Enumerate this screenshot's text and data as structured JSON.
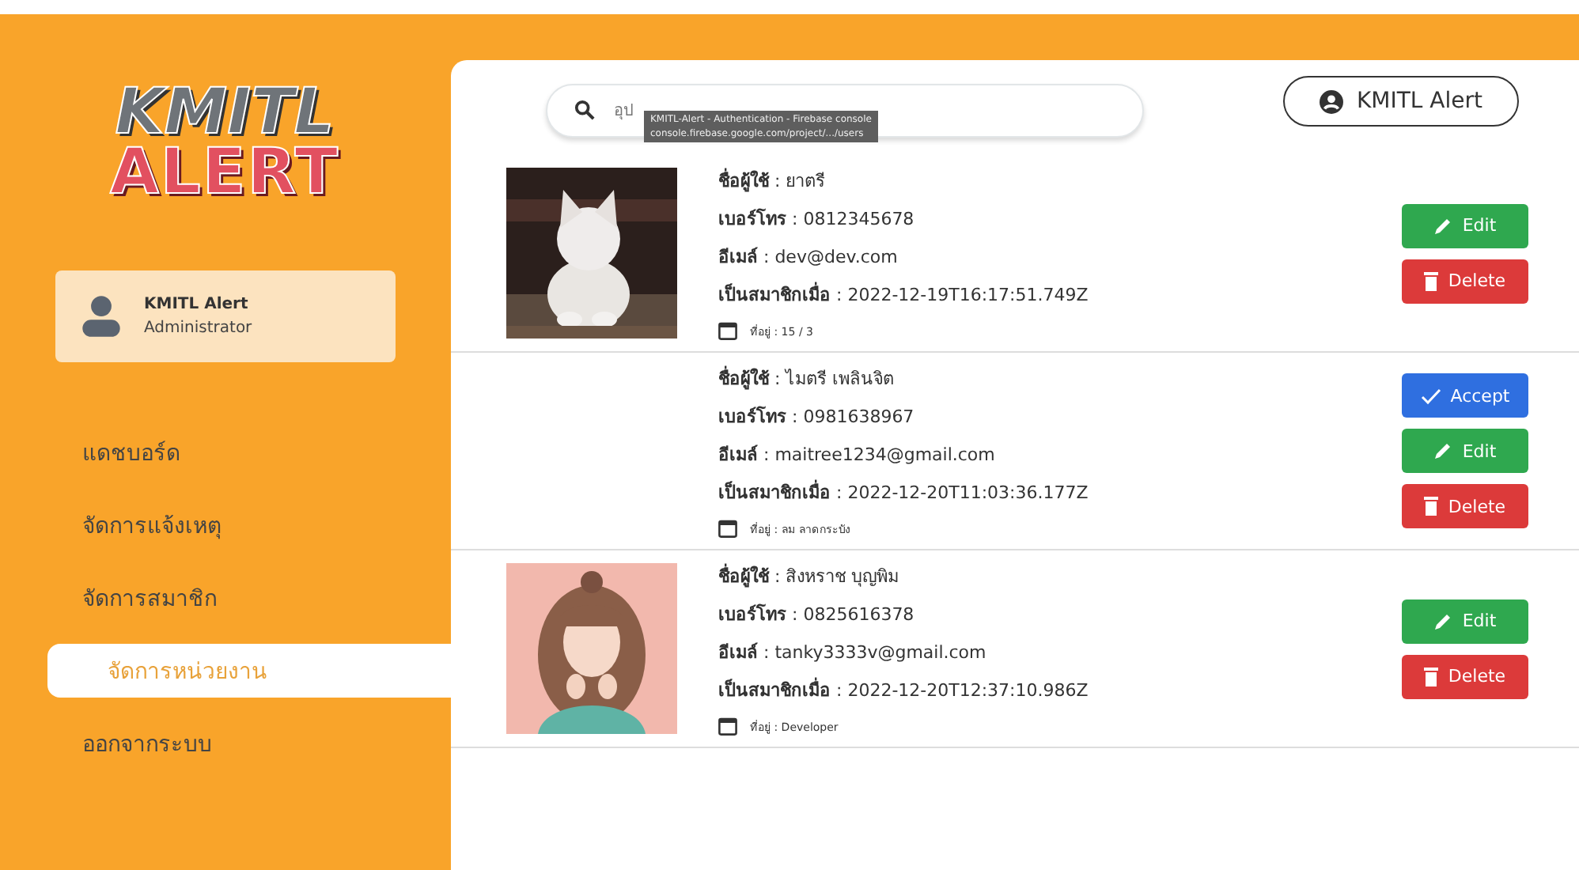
{
  "logo": {
    "line_1": "KMITL",
    "line_2": "ALERT"
  },
  "user_card": {
    "name": "KMITL Alert",
    "role": "Administrator"
  },
  "sidebar": {
    "items": [
      {
        "label": "แดชบอร์ด",
        "selected": false
      },
      {
        "label": "จัดการแจ้งเหตุ",
        "selected": false
      },
      {
        "label": "จัดการสมาชิก",
        "selected": false
      },
      {
        "label": "จัดการหน่วยงาน",
        "selected": true
      },
      {
        "label": "ออกจากระบบ",
        "selected": false
      }
    ]
  },
  "search": {
    "placeholder": "อุป"
  },
  "tooltip": {
    "title": "KMITL-Alert - Authentication - Firebase console",
    "url": "console.firebase.google.com/project/.../users"
  },
  "account_button": {
    "label": "KMITL Alert"
  },
  "members": [
    {
      "photo": {
        "kind": "picture"
      },
      "fields": [
        "**ชื่อผู้ใช้** : ยาตรี",
        "**เบอร์โทร** : 0812345678",
        "**อีเมล์** : dev@dev.com",
        "**เป็นสมาชิกเมื่อ** : 2022-12-19T16:17:51.749Z"
      ],
      "address": "ที่อยู่ : 15 / 3",
      "buttons": [
        {
          "kind": "edit",
          "label": "Edit"
        },
        {
          "kind": "delete",
          "label": "Delete"
        }
      ]
    },
    {
      "fields": [
        "**ชื่อผู้ใช้** : ไมตรี เพลินจิต",
        "**เบอร์โทร** : 0981638967",
        "**อีเมล์** : maitree1234@gmail.com",
        "**เป็นสมาชิกเมื่อ** : 2022-12-20T11:03:36.177Z"
      ],
      "address": "ที่อยู่ : ลม ลาดกระบัง",
      "buttons": [
        {
          "kind": "accept",
          "label": "Accept"
        },
        {
          "kind": "edit",
          "label": "Edit"
        },
        {
          "kind": "delete",
          "label": "Delete"
        }
      ]
    },
    {
      "photo": {
        "kind": "picture"
      },
      "fields": [
        "**ชื่อผู้ใช้** : สิงหราช บุญพิม",
        "**เบอร์โทร** : 0825616378",
        "**อีเมล์** : tanky3333v@gmail.com",
        "**เป็นสมาชิกเมื่อ** : 2022-12-20T12:37:10.986Z"
      ],
      "address": "ที่อยู่ : Developer",
      "buttons": [
        {
          "kind": "edit",
          "label": "Edit"
        },
        {
          "kind": "delete",
          "label": "Delete"
        }
      ]
    }
  ]
}
